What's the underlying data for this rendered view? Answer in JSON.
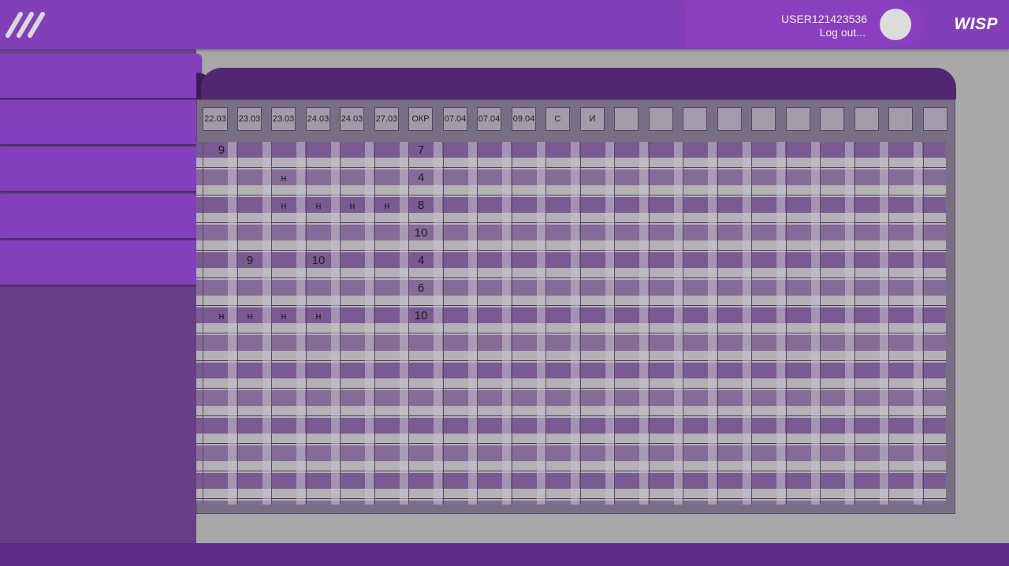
{
  "header": {
    "username": "USER121423536",
    "logout_label": "Log out...",
    "brand": "WISP"
  },
  "sidebar": {
    "items": [
      {
        "label": ""
      },
      {
        "label": ""
      },
      {
        "label": ""
      },
      {
        "label": ""
      },
      {
        "label": ""
      }
    ]
  },
  "journal": {
    "columns": [
      "22.03",
      "23.03",
      "23.03",
      "24.03",
      "24.03",
      "27.03",
      "ОКР",
      "07.04",
      "07.04",
      "09.04",
      "С",
      "И",
      "",
      "",
      "",
      "",
      "",
      "",
      "",
      "",
      "",
      ""
    ],
    "rows": [
      [
        "9",
        "",
        "",
        "",
        "",
        "",
        "7"
      ],
      [
        "",
        "",
        "н",
        "",
        "",
        "",
        "4"
      ],
      [
        "",
        "",
        "н",
        "н",
        "н",
        "н",
        "8"
      ],
      [
        "",
        "",
        "",
        "",
        "",
        "",
        "10"
      ],
      [
        "",
        "9",
        "",
        "10",
        "",
        "",
        "4"
      ],
      [
        "",
        "",
        "",
        "",
        "",
        "",
        "6"
      ],
      [
        "н",
        "н",
        "н",
        "н",
        "",
        "",
        "10"
      ]
    ]
  },
  "colors": {
    "topbar": "#8340b6",
    "sidebar": "#673f86",
    "sidebar_button": "#8240bf",
    "panel_header": "#522873",
    "bottombar": "#5e2c88"
  }
}
